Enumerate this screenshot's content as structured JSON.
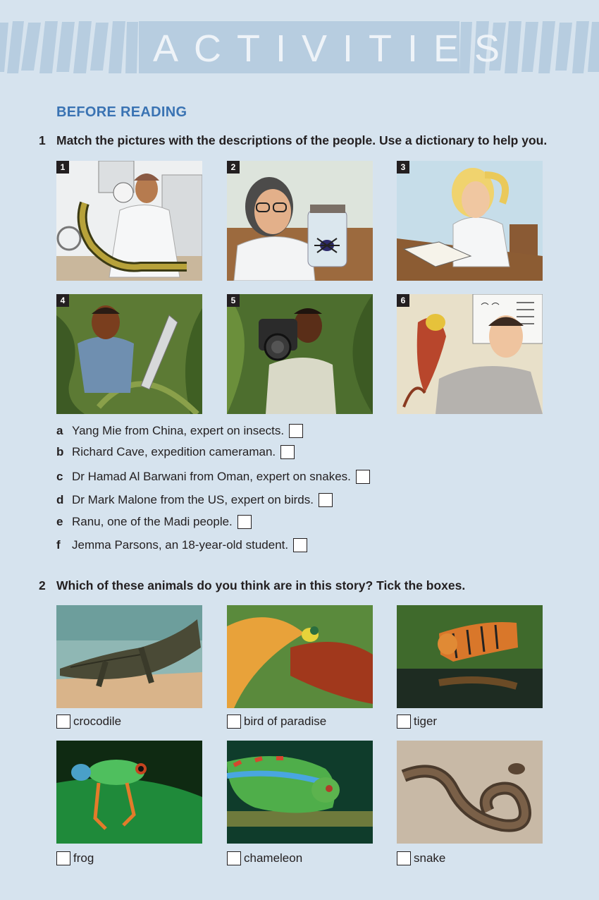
{
  "header": {
    "title": "ACTIVITIES"
  },
  "section": {
    "heading": "BEFORE READING"
  },
  "q1": {
    "number": "1",
    "text": "Match the pictures with the descriptions of the people. Use a dictionary to help you.",
    "pictures": [
      "1",
      "2",
      "3",
      "4",
      "5",
      "6"
    ],
    "descriptions": [
      {
        "letter": "a",
        "text": "Yang Mie from China, expert on insects."
      },
      {
        "letter": "b",
        "text": "Richard Cave, expedition cameraman."
      },
      {
        "letter": "c",
        "text": "Dr Hamad Al Barwani from Oman, expert on snakes."
      },
      {
        "letter": "d",
        "text": "Dr Mark Malone from the US, expert on birds."
      },
      {
        "letter": "e",
        "text": "Ranu, one of the Madi people."
      },
      {
        "letter": "f",
        "text": "Jemma Parsons, an 18-year-old student."
      }
    ]
  },
  "q2": {
    "number": "2",
    "text": "Which of these animals do you think are in this story? Tick the boxes.",
    "animals": [
      "crocodile",
      "bird of paradise",
      "tiger",
      "frog",
      "chameleon",
      "snake"
    ]
  },
  "colors": {
    "heading": "#3a73b3",
    "background": "#d6e3ee",
    "banner": "#b7cde0"
  }
}
